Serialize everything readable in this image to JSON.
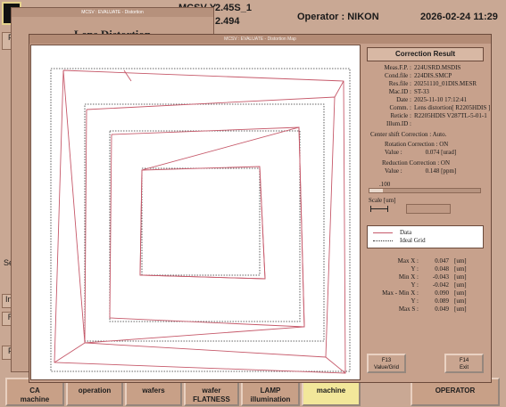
{
  "header": {
    "param1": "MCSV-Y",
    "param2": "2.45S_1",
    "param3": "2.494",
    "operator": "Operator : NIKON",
    "datetime": "2026-02-24 11:29"
  },
  "lens_window": {
    "title": "MCSV : EVALUATE - Distortion",
    "heading": "Lens Distortion",
    "left_labels": [
      "P",
      "Sea",
      "Init",
      "R",
      "P"
    ]
  },
  "distortion_window": {
    "title": "MCSV : EVALUATE - Distortion Map",
    "panel_title": "Correction Result",
    "info": {
      "meas_fp": {
        "k": "Meas.F.P. :",
        "v": "224USRD.MSDIS"
      },
      "cond_file": {
        "k": "Cond.file :",
        "v": "224DIS.SMCP"
      },
      "res_file": {
        "k": "Res.file :",
        "v": "20251110_01DIS.MESR"
      },
      "mac_id": {
        "k": "Mac.ID :",
        "v": "ST-33"
      },
      "date": {
        "k": "Date :",
        "v": "2025-11-10 17:12:41"
      },
      "comm": {
        "k": "Comm. :",
        "v": "Lens distortion[ R2205HDIS ]"
      },
      "reticle": {
        "k": "Reticle :",
        "v": "R2205HDIS V287TL-5-01-1"
      },
      "illum_id": {
        "k": "Illum.ID :",
        "v": ""
      }
    },
    "center_shift": "Center shift Correction : Auto.",
    "rotation": "Rotation Correction : ON",
    "rotation_value": {
      "k": "Value :",
      "v": "0.074",
      "u": "[urad]"
    },
    "reduction": "Reduction Correction : ON",
    "reduction_value": {
      "k": "Value :",
      "v": "0.148",
      "u": "[ppm]"
    },
    "scale_value": ".100",
    "scale_fill_fraction": 0.12,
    "scale_label": "Scale [um]",
    "legend": {
      "data": "Data",
      "ideal": "Ideal Grid"
    },
    "stats": [
      {
        "k": "Max X :",
        "v": "0.047",
        "u": "[um]"
      },
      {
        "k": "Y :",
        "v": "0.048",
        "u": "[um]"
      },
      {
        "k": "Min X :",
        "v": "-0.043",
        "u": "[um]"
      },
      {
        "k": "Y :",
        "v": "-0.042",
        "u": "[um]"
      },
      {
        "k": "Max - Min X :",
        "v": "0.090",
        "u": "[um]"
      },
      {
        "k": "Y :",
        "v": "0.089",
        "u": "[um]"
      },
      {
        "k": "Max S :",
        "v": "0.049",
        "u": "[um]"
      }
    ],
    "fkeys": {
      "f13": {
        "key": "F13",
        "label": "Value/Grid"
      },
      "f14": {
        "key": "F14",
        "label": "Exit"
      }
    }
  },
  "bottom_buttons": [
    {
      "line1": "CA",
      "line2": "machine"
    },
    {
      "line1": "",
      "line2": "operation"
    },
    {
      "line1": "",
      "line2": "wafers"
    },
    {
      "line1": "wafer",
      "line2": "FLATNESS"
    },
    {
      "line1": "LAMP",
      "line2": "illumination"
    },
    {
      "line1": "",
      "line2": "machine"
    },
    {
      "line1": "OPERATOR",
      "line2": ""
    }
  ],
  "colors": {
    "data_line": "#c6596a",
    "ideal_line": "#333333",
    "window_bg": "#c7a18c",
    "highlight_button": "#f2e79a"
  }
}
